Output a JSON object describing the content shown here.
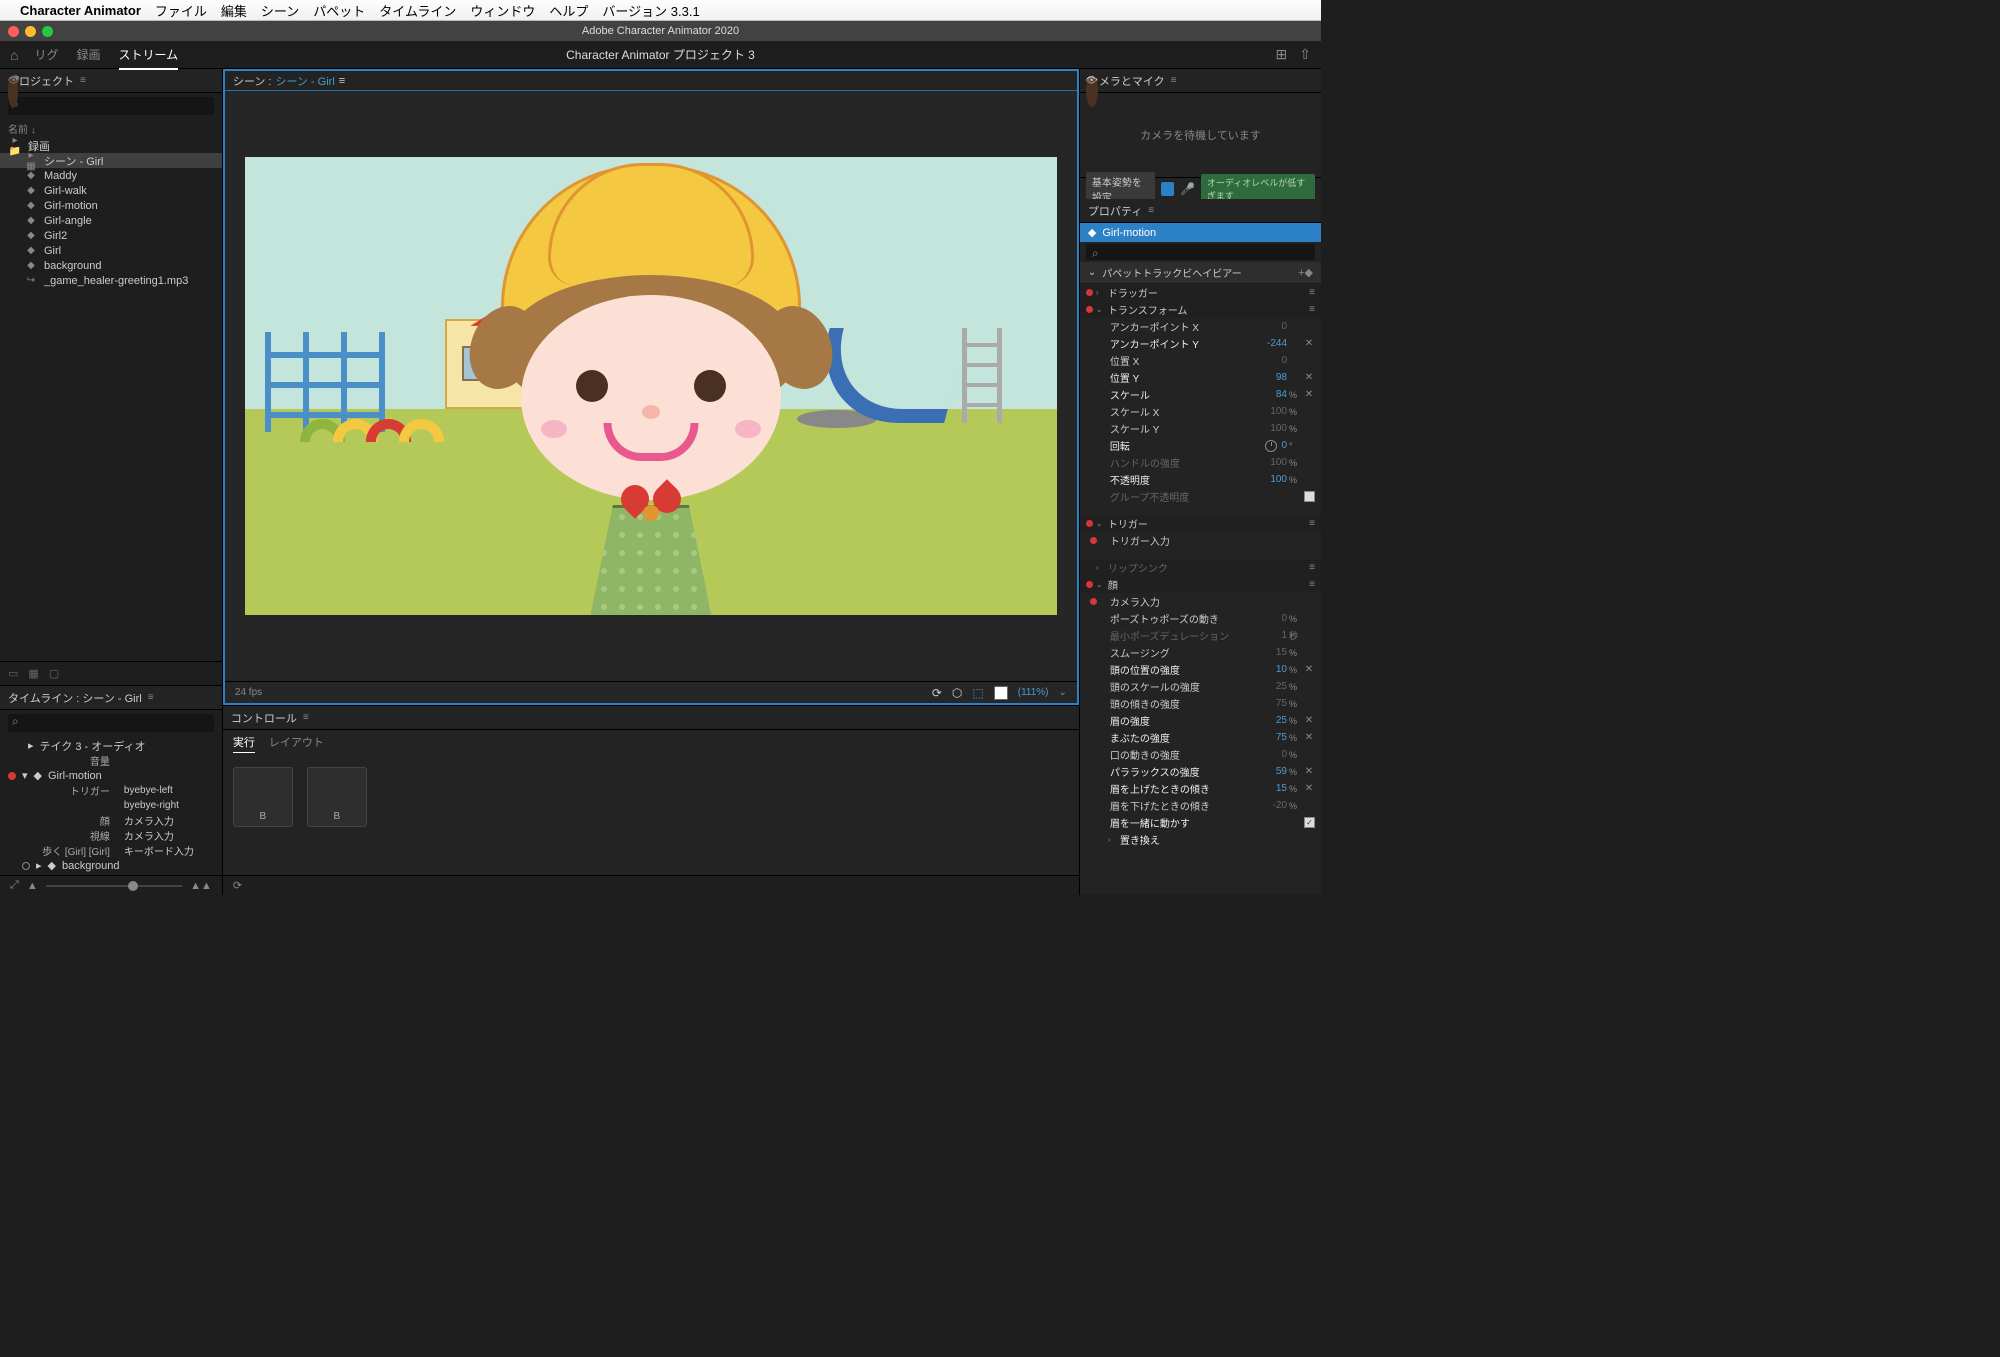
{
  "mac_menu": {
    "apple": "",
    "app": "Character Animator",
    "items": [
      "ファイル",
      "編集",
      "シーン",
      "パペット",
      "タイムライン",
      "ウィンドウ",
      "ヘルプ",
      "バージョン 3.3.1"
    ]
  },
  "window_title": "Adobe Character Animator 2020",
  "toolbar": {
    "tabs": [
      "リグ",
      "録画",
      "ストリーム"
    ],
    "active": 2,
    "project_title": "Character Animator プロジェクト 3"
  },
  "project_panel": {
    "title": "プロジェクト",
    "search_placeholder": "",
    "sort_label": "名前 ↓",
    "items": [
      {
        "type": "folder",
        "name": "録画",
        "expanded": true,
        "indent": 0,
        "selected": false
      },
      {
        "type": "scene",
        "name": "シーン - Girl",
        "indent": 1,
        "selected": true
      },
      {
        "type": "puppet",
        "name": "Maddy",
        "indent": 1
      },
      {
        "type": "puppet",
        "name": "Girl-walk",
        "indent": 1
      },
      {
        "type": "puppet",
        "name": "Girl-motion",
        "indent": 1
      },
      {
        "type": "puppet",
        "name": "Girl-angle",
        "indent": 1
      },
      {
        "type": "puppet",
        "name": "Girl2",
        "indent": 1
      },
      {
        "type": "puppet",
        "name": "Girl",
        "indent": 1
      },
      {
        "type": "puppet",
        "name": "background",
        "indent": 1
      },
      {
        "type": "audio",
        "name": "_game_healer-greeting1.mp3",
        "indent": 1
      }
    ]
  },
  "timeline_panel": {
    "title": "タイムライン : シーン - Girl",
    "search_placeholder": "",
    "take_label": "テイク 3 - オーディオ",
    "volume_label": "音量",
    "rows": [
      {
        "eye": true,
        "rec": true,
        "arrow": "▾",
        "icon": "puppet",
        "name": "Girl-motion",
        "bold": true
      },
      {
        "label": "トリガー",
        "value": "byebye-left"
      },
      {
        "label": "",
        "value": "byebye-right"
      },
      {
        "eye": true,
        "label": "顔",
        "value": "カメラ入力"
      },
      {
        "eye": true,
        "label": "視線",
        "value": "カメラ入力"
      },
      {
        "eye": true,
        "label": "歩く [Girl] [Girl]",
        "value": "キーボード入力"
      },
      {
        "eye": true,
        "circle": true,
        "arrow": "▸",
        "icon": "puppet",
        "name": "background"
      }
    ]
  },
  "scene": {
    "tab_prefix": "シーン :",
    "tab_link": "シーン - Girl",
    "fps": "24 fps",
    "zoom": "(111%)"
  },
  "controls": {
    "title": "コントロール",
    "tabs": [
      "実行",
      "レイアウト"
    ],
    "active": 0,
    "tiles": [
      "B",
      "B"
    ]
  },
  "camera": {
    "title": "カメラとマイク",
    "waiting": "カメラを待機しています",
    "set_pose": "基本姿勢を設定",
    "audio_warning": "オーディオレベルが低すぎます"
  },
  "properties": {
    "title": "プロパティ",
    "selected": "Girl-motion",
    "track_header": "パペットトラックビヘイビアー",
    "behaviors": [
      {
        "name": "ドラッガー",
        "eye": true,
        "rec": true,
        "expanded": false
      },
      {
        "name": "トランスフォーム",
        "eye": true,
        "rec": true,
        "expanded": true,
        "props": [
          {
            "name": "アンカーポイント X",
            "val": "0",
            "dim": true
          },
          {
            "name": "アンカーポイント Y",
            "val": "-244",
            "x": true,
            "bright": true
          },
          {
            "name": "位置 X",
            "val": "0",
            "dim": true
          },
          {
            "name": "位置 Y",
            "val": "98",
            "x": true,
            "bright": true
          },
          {
            "name": "スケール",
            "val": "84",
            "unit": "%",
            "x": true,
            "bright": true
          },
          {
            "name": "スケール X",
            "val": "100",
            "unit": "%",
            "dim": true
          },
          {
            "name": "スケール Y",
            "val": "100",
            "unit": "%",
            "dim": true
          },
          {
            "name": "回転",
            "val": "0",
            "unit": "°",
            "clock": true,
            "bright": true
          },
          {
            "name": "ハンドルの強度",
            "val": "100",
            "unit": "%",
            "dimname": true,
            "dim": true
          },
          {
            "name": "不透明度",
            "val": "100",
            "unit": "%",
            "bright": true
          },
          {
            "name": "グループ不透明度",
            "checkbox": false,
            "dimname": true
          }
        ]
      },
      {
        "name": "トリガー",
        "eye": true,
        "rec": true,
        "expanded": true,
        "props": [
          {
            "name": "トリガー入力",
            "rec": true,
            "novalue": true
          }
        ]
      },
      {
        "name": "リップシンク",
        "eye": false,
        "rec": false,
        "expanded": false,
        "dim": true
      },
      {
        "name": "顔",
        "eye": true,
        "rec": true,
        "expanded": true,
        "props": [
          {
            "name": "カメラ入力",
            "rec": true,
            "novalue": true
          },
          {
            "name": "ポーズトゥポーズの動き",
            "val": "0",
            "unit": "%",
            "dim": true
          },
          {
            "name": "最小ポーズデュレーション",
            "val": "1",
            "unit": "秒",
            "dimname": true,
            "dim": true
          },
          {
            "name": "スムージング",
            "val": "15",
            "unit": "%",
            "dim": true
          },
          {
            "name": "頭の位置の強度",
            "val": "10",
            "unit": "%",
            "x": true,
            "bright": true
          },
          {
            "name": "頭のスケールの強度",
            "val": "25",
            "unit": "%",
            "dim": true
          },
          {
            "name": "頭の傾きの強度",
            "val": "75",
            "unit": "%",
            "dim": true
          },
          {
            "name": "眉の強度",
            "val": "25",
            "unit": "%",
            "x": true,
            "bright": true
          },
          {
            "name": "まぶたの強度",
            "val": "75",
            "unit": "%",
            "x": true,
            "bright": true
          },
          {
            "name": "口の動きの強度",
            "val": "0",
            "unit": "%",
            "dim": true
          },
          {
            "name": "パララックスの強度",
            "val": "59",
            "unit": "%",
            "x": true,
            "bright": true
          },
          {
            "name": "眉を上げたときの傾き",
            "val": "15",
            "unit": "%",
            "x": true,
            "bright": true
          },
          {
            "name": "眉を下げたときの傾き",
            "val": "-20",
            "unit": "%",
            "dim": true
          },
          {
            "name": "眉を一緒に動かす",
            "checkbox": true,
            "bright": true
          },
          {
            "name": "置き換え",
            "arrow": true,
            "bright": true
          }
        ]
      }
    ]
  }
}
